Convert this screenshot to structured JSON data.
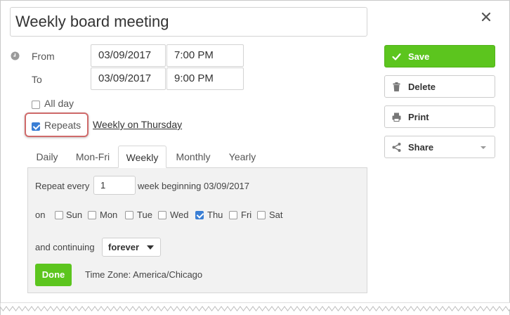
{
  "event": {
    "title": "Weekly board meeting"
  },
  "when": {
    "from_label": "From",
    "to_label": "To",
    "from_date": "03/09/2017",
    "from_time": "7:00 PM",
    "to_date": "03/09/2017",
    "to_time": "9:00 PM"
  },
  "options": {
    "all_day_label": "All day",
    "all_day_checked": false,
    "repeats_label": "Repeats",
    "repeats_checked": true,
    "repeat_summary": "Weekly on Thursday"
  },
  "repeat_tabs": [
    {
      "label": "Daily",
      "active": false
    },
    {
      "label": "Mon-Fri",
      "active": false
    },
    {
      "label": "Weekly",
      "active": true
    },
    {
      "label": "Monthly",
      "active": false
    },
    {
      "label": "Yearly",
      "active": false
    }
  ],
  "weekly": {
    "repeat_every_label": "Repeat every",
    "repeat_every_value": "1",
    "week_beginning_text": "week beginning 03/09/2017",
    "on_label": "on",
    "days": [
      {
        "label": "Sun",
        "checked": false
      },
      {
        "label": "Mon",
        "checked": false
      },
      {
        "label": "Tue",
        "checked": false
      },
      {
        "label": "Wed",
        "checked": false
      },
      {
        "label": "Thu",
        "checked": true
      },
      {
        "label": "Fri",
        "checked": false
      },
      {
        "label": "Sat",
        "checked": false
      }
    ],
    "continuing_label": "and continuing",
    "continuing_value": "forever",
    "done_label": "Done",
    "timezone_text": "Time Zone: America/Chicago"
  },
  "actions": {
    "save": "Save",
    "delete": "Delete",
    "print": "Print",
    "share": "Share"
  },
  "icons": {
    "close": "close-icon",
    "clock": "clock-icon",
    "save": "check-icon",
    "delete": "trash-icon",
    "print": "printer-icon",
    "share": "share-icon"
  },
  "colors": {
    "primary_green": "#5cc51e",
    "checkbox_blue": "#3a7fd5",
    "highlight_red": "#cf6a6a"
  }
}
